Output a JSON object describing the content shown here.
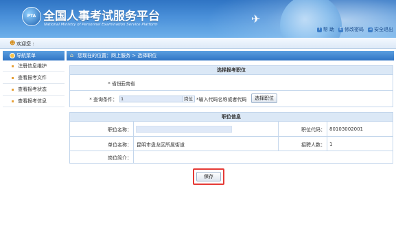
{
  "header": {
    "logo_text": "PTA",
    "title": "全国人事考试服务平台",
    "subtitle": "National Ministry of Personnel Examination Service Platform",
    "links": {
      "help": "帮 助",
      "change_password": "修改密码",
      "logout": "安全退出"
    }
  },
  "welcome": {
    "text": "欢迎您 :"
  },
  "sidebar": {
    "header": "导航菜单",
    "items": [
      {
        "label": "注册信息维护"
      },
      {
        "label": "查看报考文件"
      },
      {
        "label": "查看报考状态"
      },
      {
        "label": "查看报考信息"
      }
    ]
  },
  "breadcrumb": {
    "text": "您现在的位置：网上服务 > 选择职位"
  },
  "select_section": {
    "title": "选择报考职位",
    "province_label": "* 省份：",
    "province_value": "云南省",
    "query_label": "* 查询条件：",
    "query_value": "1",
    "query_suffix": "岗位",
    "query_hint": "*输入代码名称或者代码",
    "select_button": "选择职位"
  },
  "position_section": {
    "title": "职位信息",
    "name_label": "职位名称：",
    "code_label": "职位代码：",
    "code_value": "80103002001",
    "unit_label": "单位名称：",
    "unit_value": "昆明市盘龙区所属街道",
    "recruit_label": "招聘人数：",
    "recruit_value": "1",
    "intro_label": "岗位简介："
  },
  "actions": {
    "save": "保存"
  },
  "colors": {
    "header_blue": "#2f74c4",
    "highlight_red": "#e53935"
  }
}
